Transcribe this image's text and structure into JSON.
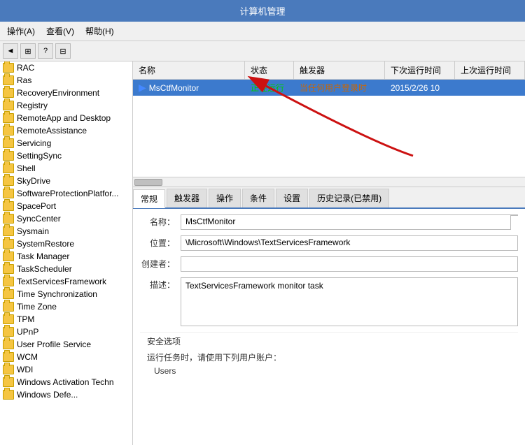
{
  "titleBar": {
    "title": "计算机管理"
  },
  "menuBar": {
    "items": [
      {
        "id": "action",
        "label": "操作(A)"
      },
      {
        "id": "view",
        "label": "查看(V)"
      },
      {
        "id": "help",
        "label": "帮助(H)"
      }
    ]
  },
  "toolbar": {
    "buttons": [
      "◄",
      "⊞",
      "?",
      "⊟"
    ]
  },
  "treeItems": [
    "RAC",
    "Ras",
    "RecoveryEnvironment",
    "Registry",
    "RemoteApp and Desktop",
    "RemoteAssistance",
    "Servicing",
    "SettingSync",
    "Shell",
    "SkyDrive",
    "SoftwareProtectionPlatform",
    "SpacePort",
    "SyncCenter",
    "Sysmain",
    "SystemRestore",
    "Task Manager",
    "TaskScheduler",
    "TextServicesFramework",
    "Time Synchronization",
    "Time Zone",
    "TPM",
    "UPnP",
    "User Profile Service",
    "WCM",
    "WDI",
    "Windows Activation Techn",
    "Windows Defe..."
  ],
  "tableHeaders": {
    "name": "名称",
    "status": "状态",
    "trigger": "触发器",
    "nextRun": "下次运行时间",
    "lastRun": "上次运行时间"
  },
  "tableRows": [
    {
      "name": "MsCtfMonitor",
      "status": "正在运行",
      "trigger": "当任何用户登录时",
      "nextRun": "2015/2/26 10",
      "lastRun": ""
    }
  ],
  "tabs": [
    {
      "id": "general",
      "label": "常规",
      "active": true
    },
    {
      "id": "trigger",
      "label": "触发器"
    },
    {
      "id": "action",
      "label": "操作"
    },
    {
      "id": "condition",
      "label": "条件"
    },
    {
      "id": "settings",
      "label": "设置"
    },
    {
      "id": "history",
      "label": "历史记录(已禁用)"
    }
  ],
  "detailFields": {
    "nameLabel": "名称：",
    "nameValue": "MsCtfMonitor",
    "locationLabel": "位置：",
    "locationValue": "\\Microsoft\\Windows\\TextServicesFramework",
    "authorLabel": "创建者：",
    "authorValue": "",
    "descLabel": "描述：",
    "descValue": "TextServicesFramework monitor task"
  },
  "securitySection": {
    "title": "安全选项",
    "runLabel": "运行任务时，请使用下列用户账户：",
    "userValue": "Users"
  }
}
